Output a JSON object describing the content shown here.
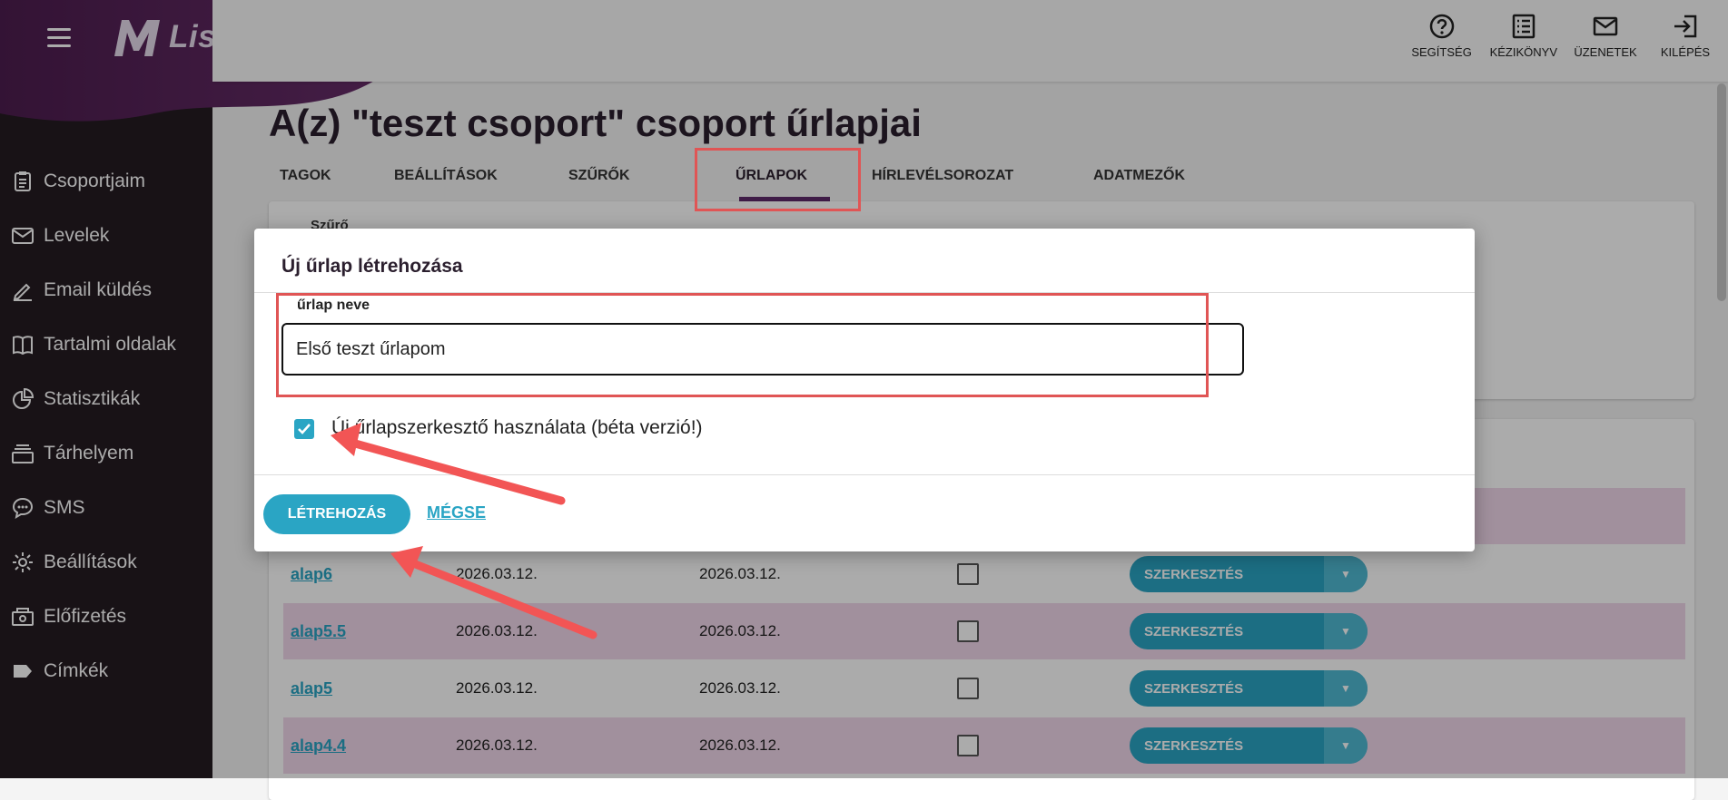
{
  "app": {
    "name": "ListaMester"
  },
  "sidebar": {
    "items": [
      {
        "label": "Csoportjaim",
        "icon": "clipboard-icon"
      },
      {
        "label": "Levelek",
        "icon": "envelope-icon"
      },
      {
        "label": "Email küldés",
        "icon": "pencil-icon"
      },
      {
        "label": "Tartalmi oldalak",
        "icon": "book-icon"
      },
      {
        "label": "Statisztikák",
        "icon": "pie-chart-icon"
      },
      {
        "label": "Tárhelyem",
        "icon": "storage-icon"
      },
      {
        "label": "SMS",
        "icon": "chat-icon"
      },
      {
        "label": "Beállítások",
        "icon": "gear-icon"
      },
      {
        "label": "Előfizetés",
        "icon": "subscription-icon"
      },
      {
        "label": "Címkék",
        "icon": "tag-icon"
      }
    ]
  },
  "topbar": {
    "help": "SEGÍTSÉG",
    "manual": "KÉZIKÖNYV",
    "messages": "ÜZENETEK",
    "logout": "KILÉPÉS"
  },
  "page": {
    "title": "A(z) \"teszt csoport\" csoport űrlapjai",
    "tabs": [
      "TAGOK",
      "BEÁLLÍTÁSOK",
      "SZŰRŐK",
      "ŰRLAPOK",
      "HÍRLEVÉLSOROZAT",
      "ADATMEZŐK"
    ],
    "active_tab": "ŰRLAPOK",
    "filter_label": "Szűrő"
  },
  "table": {
    "rows": [
      {
        "name": "alap6",
        "created": "2026.03.12.",
        "modified": "2026.03.12.",
        "action": "SZERKESZTÉS"
      },
      {
        "name": "alap5.5",
        "created": "2026.03.12.",
        "modified": "2026.03.12.",
        "action": "SZERKESZTÉS"
      },
      {
        "name": "alap5",
        "created": "2026.03.12.",
        "modified": "2026.03.12.",
        "action": "SZERKESZTÉS"
      },
      {
        "name": "alap4.4",
        "created": "2026.03.12.",
        "modified": "2026.03.12.",
        "action": "SZERKESZTÉS"
      }
    ]
  },
  "dialog": {
    "title": "Új űrlap létrehozása",
    "field_label": "űrlap neve",
    "field_value": "Első teszt űrlapom",
    "checkbox_label": "Új űrlapszerkesztő használata (béta verzió!)",
    "checkbox_checked": true,
    "create_label": "LÉTREHOZÁS",
    "cancel_label": "MÉGSE"
  },
  "colors": {
    "accent": "#2aa5c4",
    "sidebar_bg": "#241b22",
    "brand_purple": "#5e2a6a",
    "highlight_red": "#e05555"
  }
}
